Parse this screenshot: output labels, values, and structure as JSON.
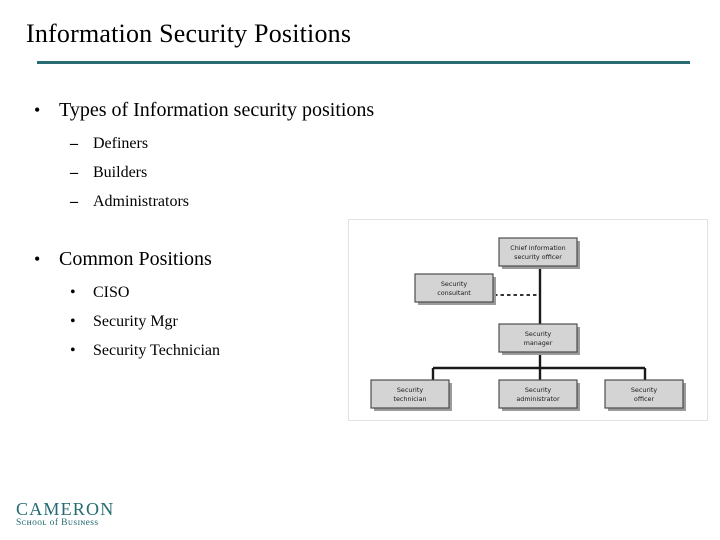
{
  "slide": {
    "title": "Information Security Positions",
    "accent_color": "#2a6b72"
  },
  "content": {
    "bullets": [
      {
        "marker": "•",
        "text": "Types of Information security positions",
        "children": [
          {
            "marker": "–",
            "text": "Definers"
          },
          {
            "marker": "–",
            "text": "Builders"
          },
          {
            "marker": "–",
            "text": "Administrators"
          }
        ]
      },
      {
        "marker": "•",
        "text": "Common Positions",
        "children": [
          {
            "marker": "•",
            "text": "CISO"
          },
          {
            "marker": "•",
            "text": "Security Mgr"
          },
          {
            "marker": "•",
            "text": "Security Technician"
          }
        ]
      }
    ]
  },
  "org_chart": {
    "box_fill": "#d4d4d4",
    "box_stroke": "#4d4d4d",
    "line_color": "#1a1a1a",
    "nodes": {
      "ciso_line1": "Chief information",
      "ciso_line2": "security officer",
      "consultant_line1": "Security",
      "consultant_line2": "consultant",
      "manager_line1": "Security",
      "manager_line2": "manager",
      "technician_line1": "Security",
      "technician_line2": "technician",
      "administrator_line1": "Security",
      "administrator_line2": "administrator",
      "officer_line1": "Security",
      "officer_line2": "officer"
    }
  },
  "footer": {
    "logo_main": "CAMERON",
    "logo_sub": "Sᴄʜooʟ of Bᴜѕɪɴеѕѕ",
    "logo_color": "#246b72"
  }
}
